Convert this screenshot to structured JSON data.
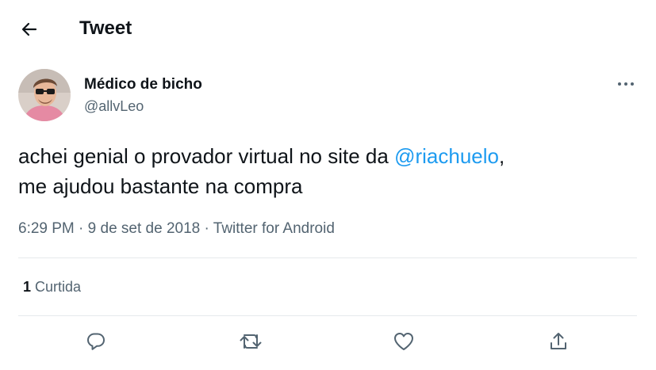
{
  "header": {
    "back_icon": "arrow-left-icon",
    "title": "Tweet"
  },
  "tweet": {
    "author": {
      "display_name": "Médico de bicho",
      "handle": "@allvLeo",
      "avatar_icon": "avatar-photo"
    },
    "more_icon": "more-horizontal-icon",
    "text_before": "achei genial o provador virtual no site da ",
    "mention": "@riachuelo",
    "text_after": ",\nme ajudou bastante na compra",
    "time": "6:29 PM",
    "date": "9 de set de 2018",
    "source": "Twitter for Android",
    "separator": "·",
    "likes": {
      "count": "1",
      "label": "Curtida"
    }
  },
  "actions": [
    {
      "name": "reply",
      "icon": "reply-icon"
    },
    {
      "name": "retweet",
      "icon": "retweet-icon"
    },
    {
      "name": "like",
      "icon": "heart-icon"
    },
    {
      "name": "share",
      "icon": "share-icon"
    }
  ],
  "colors": {
    "text_primary": "#0f1419",
    "text_secondary": "#536471",
    "accent": "#1d9bf0",
    "divider": "#e6e9ec"
  }
}
